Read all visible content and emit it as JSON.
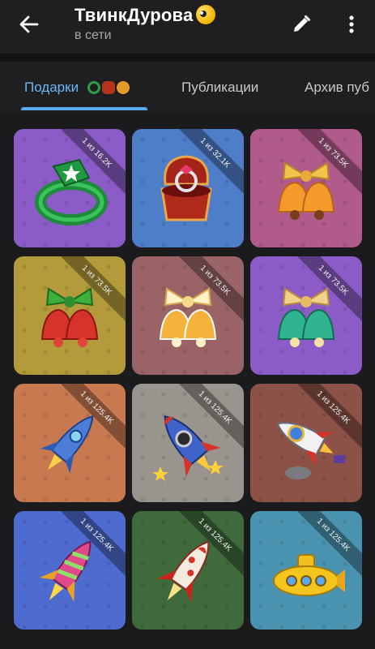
{
  "header": {
    "title": "ТвинкДурова",
    "status": "в сети"
  },
  "tabs": [
    {
      "label": "Подарки"
    },
    {
      "label": "Публикации"
    },
    {
      "label": "Архив пуб"
    }
  ],
  "colors": {
    "accent": "#5aa8ef",
    "header_bg": "#1f1f21",
    "card_purple": "#8b5cc7",
    "card_blue": "#4f7ec9",
    "card_pink": "#b15a8c",
    "card_olive": "#b39a3a",
    "card_mauve": "#9a6466",
    "card_orange": "#c87950",
    "card_gray": "#9a948e",
    "card_brown": "#8d5247",
    "card_green": "#3f6a3c",
    "card_teal": "#4a93b0"
  },
  "gifts": [
    {
      "edition": "1 из 16.2K",
      "icon": "ring-icon"
    },
    {
      "edition": "1 из 32.1K",
      "icon": "ring-box-icon"
    },
    {
      "edition": "1 из 73.5K",
      "icon": "bells-icon"
    },
    {
      "edition": "1 из 73.5K",
      "icon": "bells-icon"
    },
    {
      "edition": "1 из 73.5K",
      "icon": "bells-icon"
    },
    {
      "edition": "1 из 73.5K",
      "icon": "bells-icon"
    },
    {
      "edition": "1 из 125.4K",
      "icon": "rocket-icon"
    },
    {
      "edition": "1 из 125.4K",
      "icon": "rocket-icon"
    },
    {
      "edition": "1 из 125.4K",
      "icon": "rocket-icon"
    },
    {
      "edition": "1 из 125.4K",
      "icon": "rocket-icon"
    },
    {
      "edition": "1 из 125.4K",
      "icon": "rocket-icon"
    },
    {
      "edition": "1 из 125.4K",
      "icon": "submarine-icon"
    }
  ]
}
